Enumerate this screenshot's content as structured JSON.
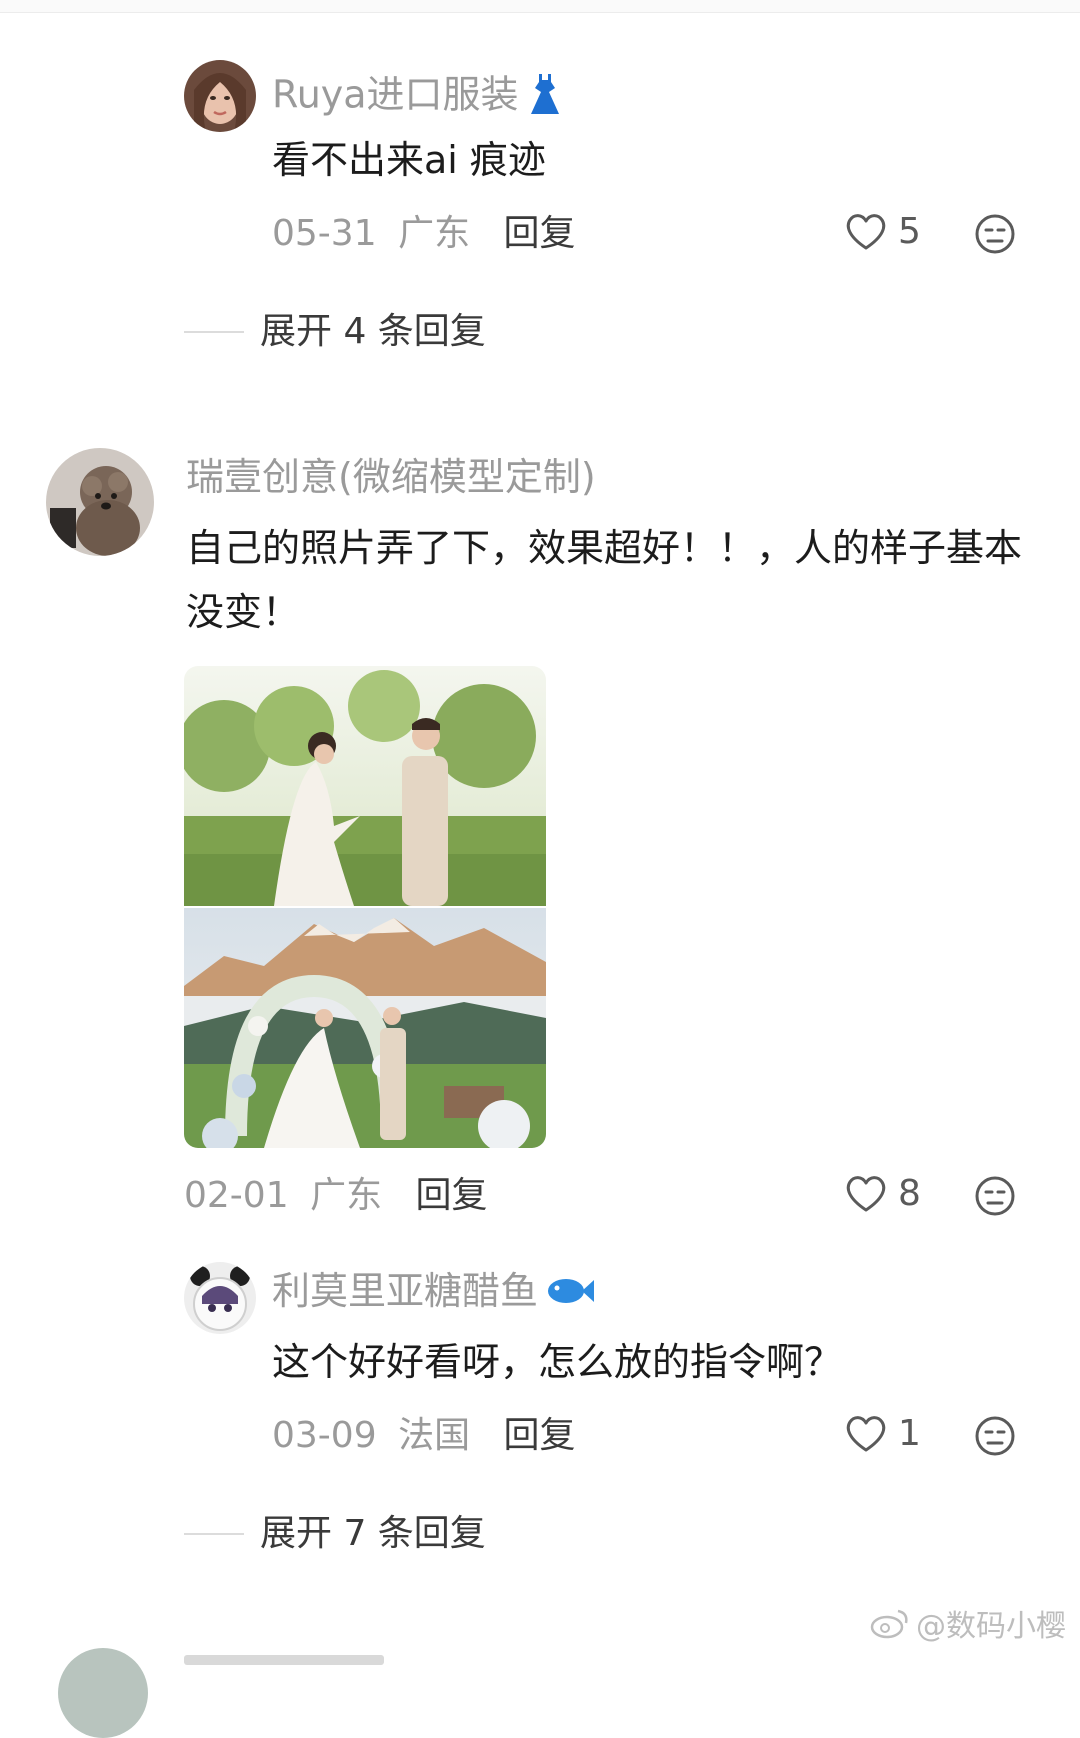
{
  "comments": [
    {
      "username": "Ruya进口服装",
      "username_badge": "dress-emoji",
      "text": "看不出来ai 痕迹",
      "date": "05-31",
      "location": "广东",
      "reply_label": "回复",
      "likes": "5",
      "expand_label": "展开 4 条回复"
    },
    {
      "username": "瑞壹创意(微缩模型定制)",
      "text": "自己的照片弄了下，效果超好！！，人的样子基本没变！",
      "date": "02-01",
      "location": "广东",
      "reply_label": "回复",
      "likes": "8",
      "images": [
        "wedding-photo-meadow",
        "wedding-photo-mountain-arch"
      ],
      "replies": [
        {
          "username": "利莫里亚糖醋鱼",
          "username_badge": "fish-emoji",
          "text": "这个好好看呀，怎么放的指令啊？",
          "date": "03-09",
          "location": "法国",
          "reply_label": "回复",
          "likes": "1"
        }
      ],
      "expand_label": "展开 7 条回复"
    }
  ],
  "watermark": "@数码小樱",
  "colors": {
    "meta_gray": "#9a9a9a",
    "text_dark": "#1c1c1c",
    "icon_gray": "#5a5a5a"
  }
}
